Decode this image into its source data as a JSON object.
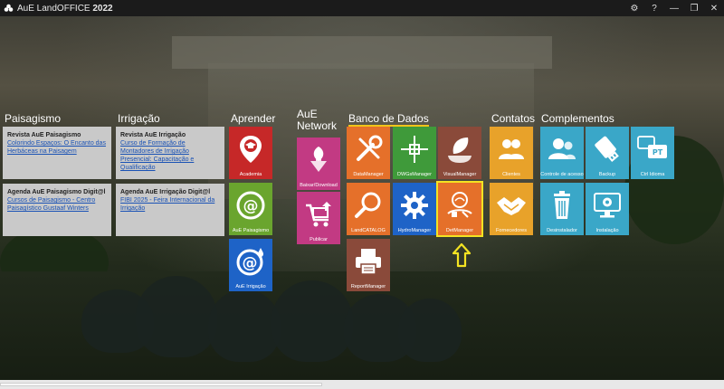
{
  "window": {
    "title_prefix": "AuE LandOFFICE",
    "title_year": "2022",
    "buttons": {
      "settings": "⚙",
      "help": "?",
      "minimize": "—",
      "maximize": "❐",
      "close": "✕"
    }
  },
  "sections": {
    "paisagismo": "Paisagismo",
    "irrigacao": "Irrigação",
    "aprender": "Aprender",
    "aue_network_line1": "AuE",
    "aue_network_line2": "Network",
    "banco_de_dados": "Banco de Dados",
    "contatos": "Contatos",
    "complementos": "Complementos"
  },
  "news": {
    "revista_paisagismo": {
      "title": "Revista AuE Paisagismo",
      "link": "Colorindo Espaços: O Encanto das Herbáceas na Paisagem"
    },
    "revista_irrigacao": {
      "title": "Revista AuE Irrigação",
      "link": "Curso de Formação de Montadores de Irrigação Presencial: Capacitação e Qualificação"
    },
    "agenda_paisagismo": {
      "title": "Agenda AuE Paisagismo Digit@l",
      "link": "Cursos de Paisagismo - Centro Paisagístico Gustaaf Winters"
    },
    "agenda_irrigacao": {
      "title": "Agenda AuE Irrigação Digit@l",
      "link": "FIBI 2025 - Feira Internacional da Irrigação"
    }
  },
  "tiles": {
    "academia": "Academia",
    "aue_paisagismo": "AuE Paisagismo",
    "aue_irrigacao": "AuE Irrigação",
    "baixar_download": "Baixar/Download",
    "publicar": "Publicar",
    "datamanager": "DataManager",
    "dwgmanager": "DWGsManager",
    "visualmanager": "VisualManager",
    "landcatalog": "LandCATALOG",
    "hydromanager": "HydroManager",
    "detmanager": "DetManager",
    "reportmanager": "ReportManager",
    "clientes": "Clientes",
    "fornecedores": "Fornecedores",
    "controle_acesso": "Controle de acesso",
    "backup": "Backup",
    "ctrl_idioma": "Ctrl Idioma",
    "desinstalador": "Desinstalador",
    "instalacao": "Instalação"
  },
  "colors": {
    "red": "#c62828",
    "green": "#6aa52e",
    "blue": "#1e63c7",
    "pink": "#c23a83",
    "orange": "#e5702a",
    "brown": "#8a4a3a",
    "amber": "#e8a22a",
    "teal": "#3aa7c8",
    "highlight": "#f3e322"
  },
  "icons": {
    "pt_badge": "PT"
  }
}
